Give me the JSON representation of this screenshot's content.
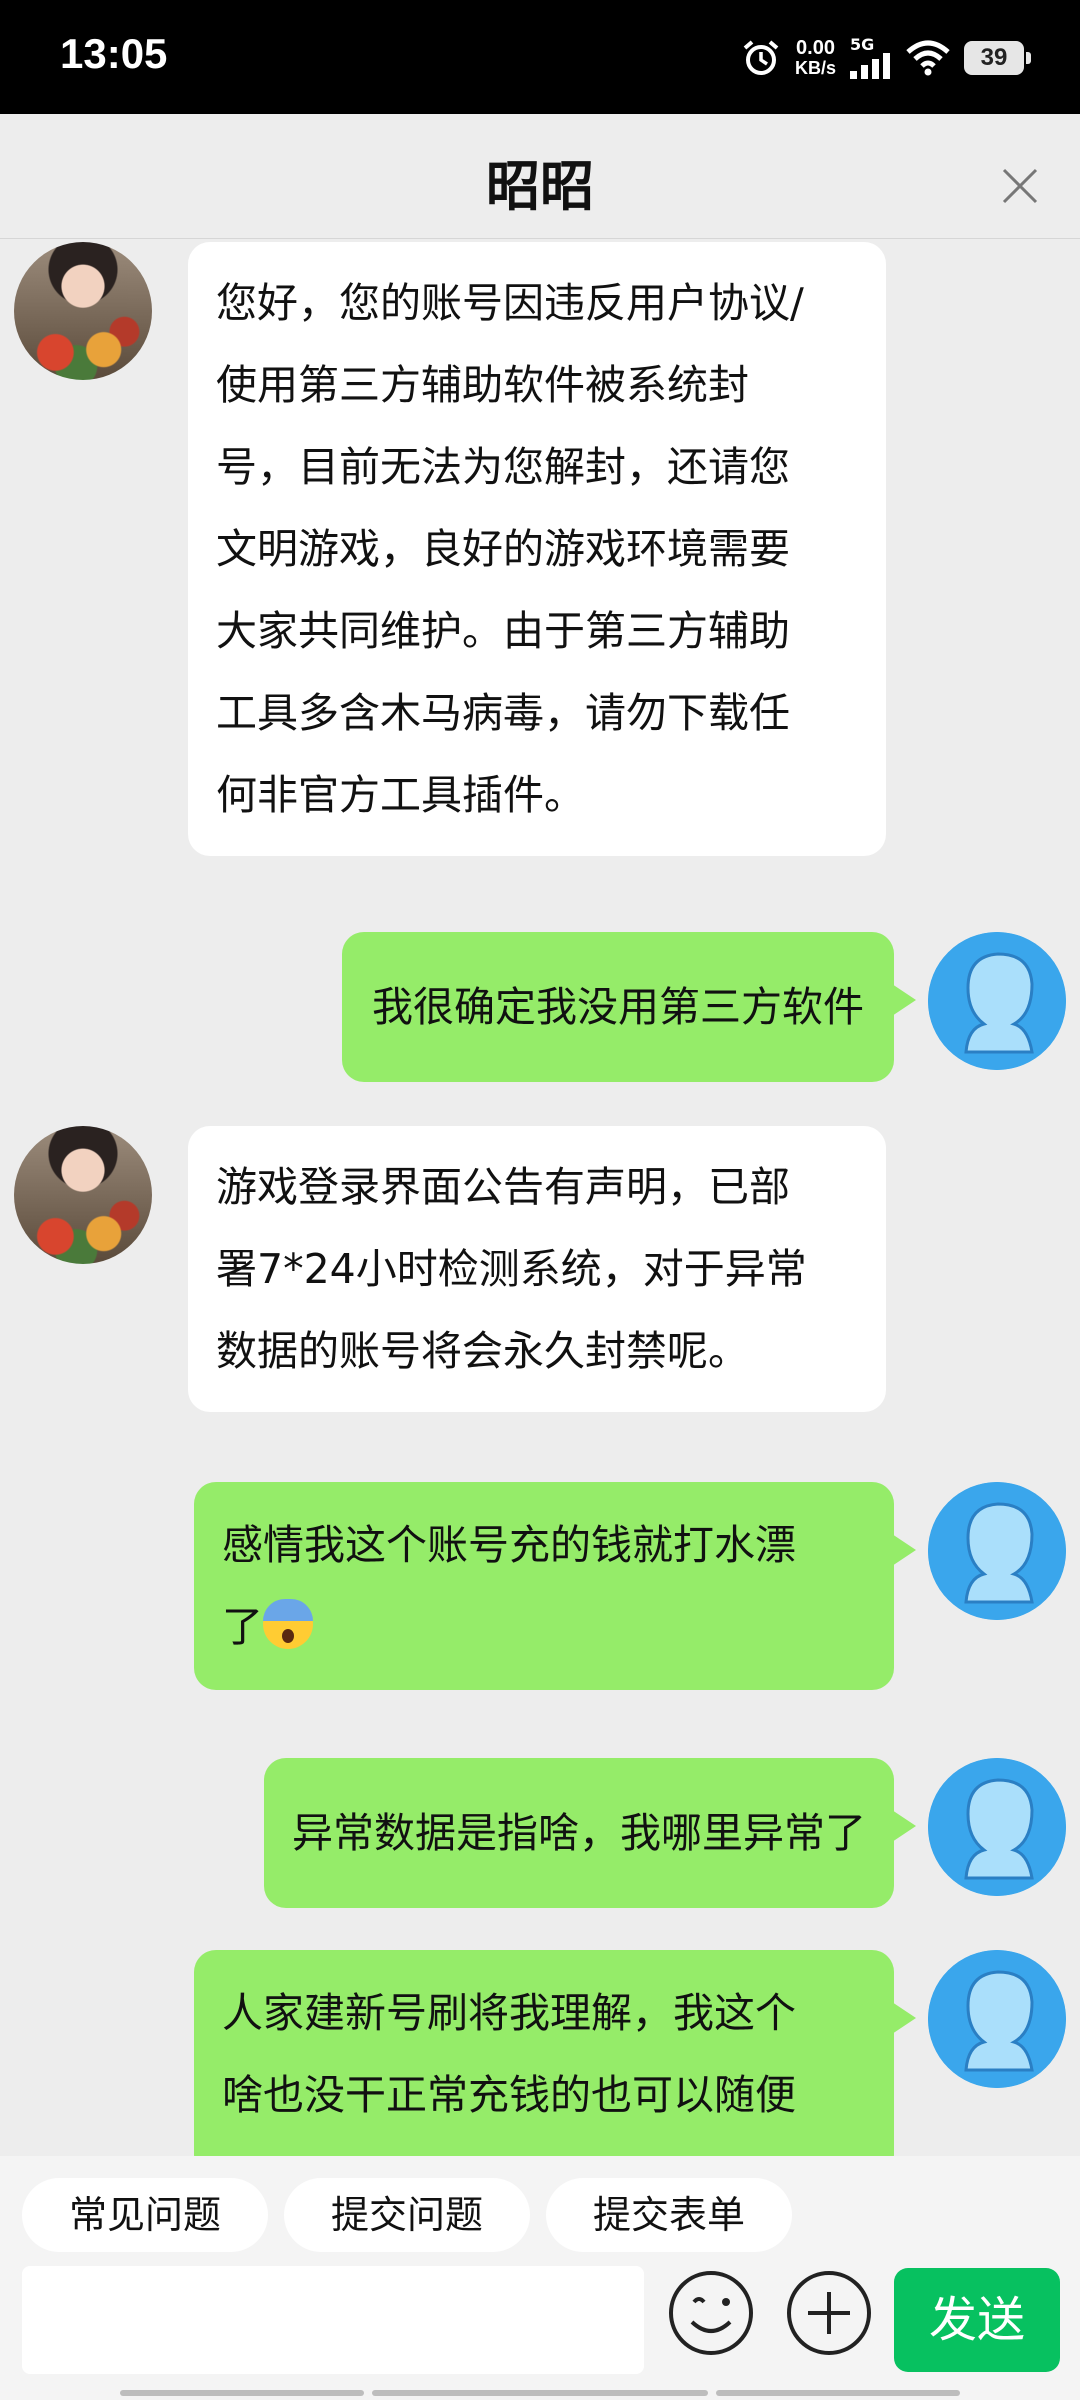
{
  "status_bar": {
    "time": "13:05",
    "net_speed_value": "0.00",
    "net_speed_unit": "KB/s",
    "network_type": "5G",
    "battery": "39",
    "icons": [
      "alarm-icon",
      "signal-icon",
      "wifi-icon",
      "battery-icon"
    ]
  },
  "header": {
    "title": "昭昭",
    "close_icon": "close-icon"
  },
  "messages": [
    {
      "sender": "agent",
      "lines": [
        "您好，您的账号因违反用户协议/",
        "使用第三方辅助软件被系统封",
        "号，目前无法为您解封，还请您",
        "文明游戏，良好的游戏环境需要",
        "大家共同维护。由于第三方辅助",
        "工具多含木马病毒，请勿下载任",
        "何非官方工具插件。"
      ]
    },
    {
      "sender": "user",
      "lines": [
        "我很确定我没用第三方软件"
      ]
    },
    {
      "sender": "agent",
      "lines": [
        "游戏登录界面公告有声明，已部",
        "署7*24小时检测系统，对于异常",
        "数据的账号将会永久封禁呢。"
      ]
    },
    {
      "sender": "user",
      "lines": [
        "感情我这个账号充的钱就打水漂",
        "了"
      ],
      "emoji": "fearful-face-emoji"
    },
    {
      "sender": "user",
      "lines": [
        "异常数据是指啥，我哪里异常了"
      ]
    },
    {
      "sender": "user",
      "lines": [
        "人家建新号刷将我理解，我这个",
        "啥也没干正常充钱的也可以随便"
      ]
    }
  ],
  "quick_actions": [
    "常见问题",
    "提交问题",
    "提交表单"
  ],
  "input": {
    "placeholder": "",
    "emoji_icon": "emoji-icon",
    "plus_icon": "plus-icon",
    "send_label": "发送"
  },
  "colors": {
    "agent_bubble": "#ffffff",
    "user_bubble": "#95ec69",
    "send_button": "#07c160",
    "background": "#ededed",
    "user_avatar": "#3aa6ec"
  }
}
